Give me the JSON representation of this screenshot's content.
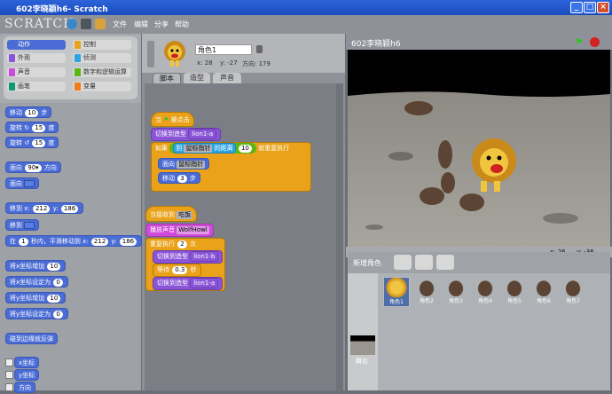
{
  "window": {
    "title": "602李晓颖h6- Scratch"
  },
  "menu": {
    "logo": "SCRATCH",
    "items": [
      "文件",
      "编辑",
      "分享",
      "帮助"
    ]
  },
  "categories": [
    {
      "label": "动作",
      "color": "#4a6cd4",
      "selected": true
    },
    {
      "label": "控制",
      "color": "#e9a21a"
    },
    {
      "label": "外观",
      "color": "#8a55d7"
    },
    {
      "label": "侦测",
      "color": "#2ca5e2"
    },
    {
      "label": "声音",
      "color": "#cf4ad9"
    },
    {
      "label": "数字和逻辑运算",
      "color": "#5cb712"
    },
    {
      "label": "画笔",
      "color": "#0e9a6c"
    },
    {
      "label": "变量",
      "color": "#ee7d16"
    }
  ],
  "palette": {
    "move": [
      "移动",
      "10",
      "步"
    ],
    "turn_cw": [
      "旋转",
      "15",
      "度"
    ],
    "turn_ccw": [
      "旋转",
      "15",
      "度"
    ],
    "point_dir": [
      "面向",
      "90▾",
      "方向"
    ],
    "point_to": "面向",
    "goto_xy": [
      "移到 x:",
      "212",
      "y:",
      "186"
    ],
    "goto": "移到",
    "glide": [
      "在",
      "1",
      "秒内，平滑移动到 x:",
      "212",
      "y:",
      "186"
    ],
    "change_x": [
      "将x坐标增加",
      "10"
    ],
    "set_x": [
      "将x坐标设定为",
      "0"
    ],
    "change_y": [
      "将y坐标增加",
      "10"
    ],
    "set_y": [
      "将y坐标设定为",
      "0"
    ],
    "bounce": "碰到边缘就反弹",
    "xpos": "x坐标",
    "ypos": "y坐标",
    "direction": "方向"
  },
  "sprite": {
    "name": "角色1",
    "x_label": "x: 28",
    "y_label": "y: -27",
    "dir_label": "方向: 179"
  },
  "tabs": [
    "脚本",
    "造型",
    "声音"
  ],
  "script1": {
    "hat": [
      "当",
      "被点击"
    ],
    "costume": [
      "切换到造型",
      "lion1-a"
    ],
    "if": [
      "如果",
      "到",
      "鼠标指针",
      "的距离",
      "10",
      "就重复执行"
    ],
    "point": [
      "面向",
      "鼠标指针"
    ],
    "move": [
      "移动",
      "3",
      "步"
    ]
  },
  "script2": {
    "hat": [
      "当接收到",
      "吃饭"
    ],
    "sound": [
      "播放声音",
      "WolfHowl"
    ],
    "repeat": [
      "重复执行",
      "2",
      "次"
    ],
    "costume1": [
      "切换到造型",
      "lion1-b"
    ],
    "wait": [
      "等待",
      "0.3",
      "秒"
    ],
    "costume2": [
      "切换到造型",
      "lion1-a"
    ]
  },
  "stage": {
    "title": "602李晓颖h6",
    "mouse_x": "x: 26",
    "mouse_y": "y: -36"
  },
  "new_sprite": {
    "label": "新增角色"
  },
  "sprites": [
    "角色1",
    "角色2",
    "角色3",
    "角色4",
    "角色5",
    "角色6",
    "角色7"
  ],
  "stage_thumb": {
    "label": "舞台"
  }
}
